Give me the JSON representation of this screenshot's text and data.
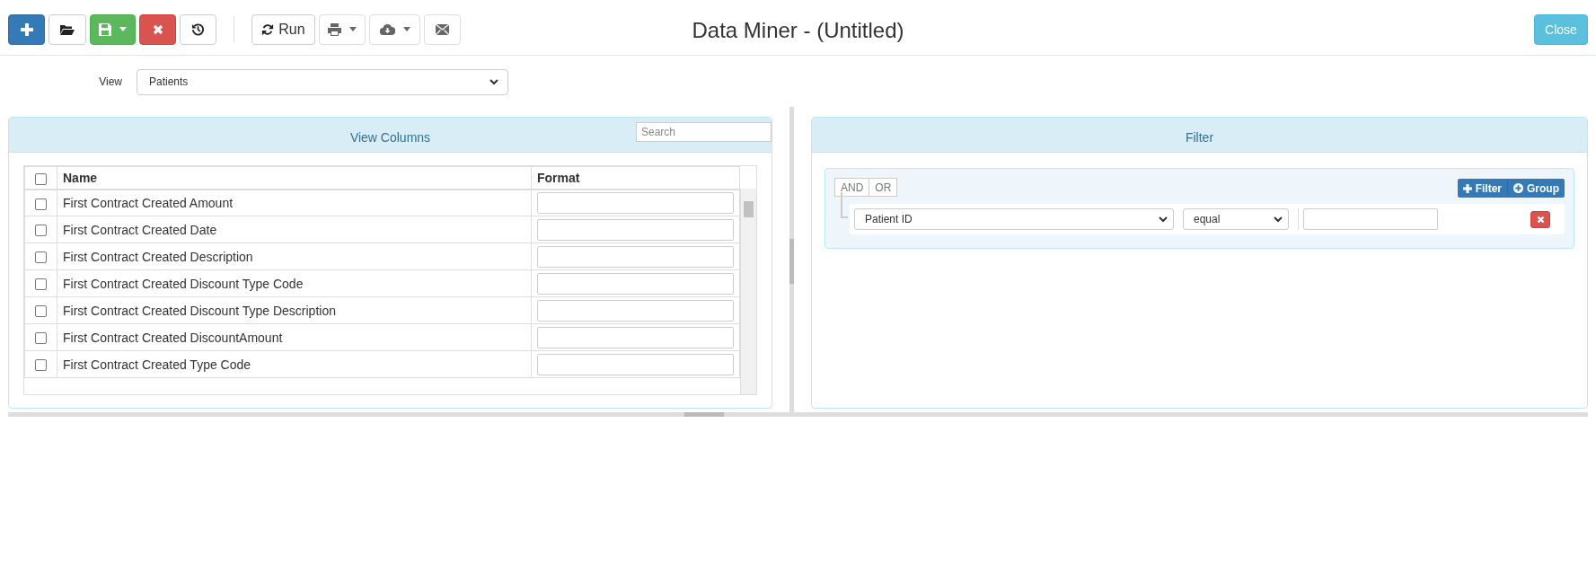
{
  "toolbar": {
    "buttons": [
      {
        "kind": "new",
        "dropdown": false
      },
      {
        "kind": "open",
        "dropdown": false
      },
      {
        "kind": "save",
        "dropdown": true
      },
      {
        "kind": "delete",
        "dropdown": false
      },
      {
        "kind": "history",
        "dropdown": false
      },
      {
        "kind": "run",
        "dropdown": false,
        "label": "Run"
      },
      {
        "kind": "print",
        "dropdown": true
      },
      {
        "kind": "download",
        "dropdown": true
      },
      {
        "kind": "email",
        "dropdown": false
      }
    ]
  },
  "title": "Data Miner - (Untitled)",
  "close_button": "Close",
  "view": {
    "label": "View",
    "value": "Patients"
  },
  "columns_panel": {
    "title": "View Columns",
    "search_placeholder": "Search",
    "select_all_checked": false,
    "headers": [
      "Name",
      "Format"
    ],
    "rows": [
      {
        "name": "First Contract Created Amount",
        "checked": false
      },
      {
        "name": "First Contract Created Date",
        "checked": false
      },
      {
        "name": "First Contract Created Description",
        "checked": false
      },
      {
        "name": "First Contract Created Discount Type Code",
        "checked": false
      },
      {
        "name": "First Contract Created Discount Type Description",
        "checked": false
      },
      {
        "name": "First Contract Created DiscountAmount",
        "checked": false
      },
      {
        "name": "First Contract Created Type Code",
        "checked": false
      }
    ]
  },
  "filter_panel": {
    "title": "Filter",
    "conditions": [
      "AND",
      "OR"
    ],
    "buttons": [
      {
        "kind": "add-filter",
        "label": "Filter"
      },
      {
        "kind": "add-group",
        "label": "Group"
      }
    ],
    "rules": [
      {
        "field": "Patient ID",
        "operator": "equal"
      }
    ]
  }
}
